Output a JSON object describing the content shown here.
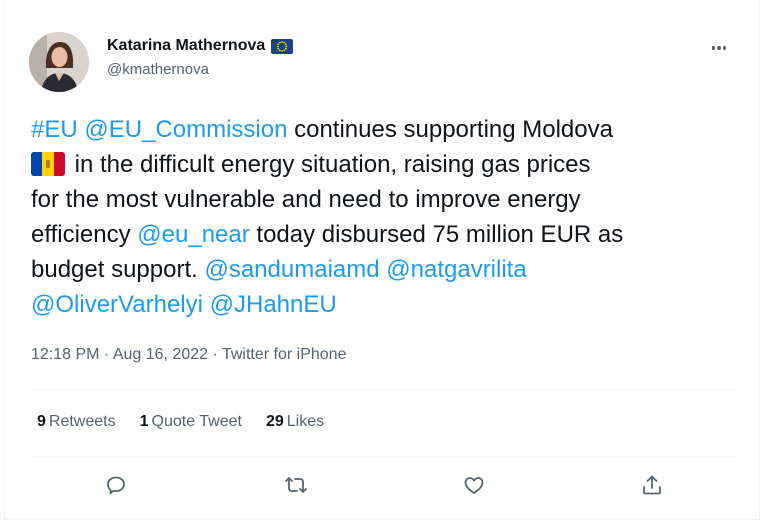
{
  "author": {
    "name": "Katarina Mathernova",
    "handle": "@kmathernova",
    "badge_icon": "eu-flag-icon"
  },
  "tweet": {
    "lines": [
      [
        {
          "text": "#EU",
          "link": true
        },
        {
          "text": " ",
          "link": false
        },
        {
          "text": "@EU_Commission",
          "link": true
        },
        {
          "text": " continues supporting Moldova",
          "link": false
        }
      ],
      [
        {
          "emoji": "moldova-flag-icon"
        },
        {
          "text": " in the difficult energy situation, raising gas prices",
          "link": false
        }
      ],
      [
        {
          "text": "for the most vulnerable and need to improve energy",
          "link": false
        }
      ],
      [
        {
          "text": "efficiency ",
          "link": false
        },
        {
          "text": "@eu_near",
          "link": true
        },
        {
          "text": " today disbursed 75 million EUR as",
          "link": false
        }
      ],
      [
        {
          "text": "budget support. ",
          "link": false
        },
        {
          "text": "@sandumaiamd",
          "link": true
        },
        {
          "text": " ",
          "link": false
        },
        {
          "text": "@natgavrilita",
          "link": true
        }
      ],
      [
        {
          "text": "@OliverVarhelyi",
          "link": true
        },
        {
          "text": " ",
          "link": false
        },
        {
          "text": "@JHahnEU",
          "link": true
        }
      ]
    ]
  },
  "meta": {
    "time": "12:18 PM",
    "sep1": " · ",
    "date": "Aug 16, 2022",
    "sep2": " · ",
    "source": "Twitter for iPhone"
  },
  "stats": {
    "retweets_count": "9",
    "retweets_label": "Retweets",
    "quotes_count": "1",
    "quotes_label": "Quote Tweet",
    "likes_count": "29",
    "likes_label": "Likes"
  },
  "colors": {
    "link": "#1d9bf0",
    "text": "#0f1419",
    "muted": "#536471",
    "divider": "#eff3f4"
  },
  "icons": {
    "more": "more-horizontal-icon",
    "reply": "reply-icon",
    "retweet": "retweet-icon",
    "like": "like-icon",
    "share": "share-icon"
  }
}
